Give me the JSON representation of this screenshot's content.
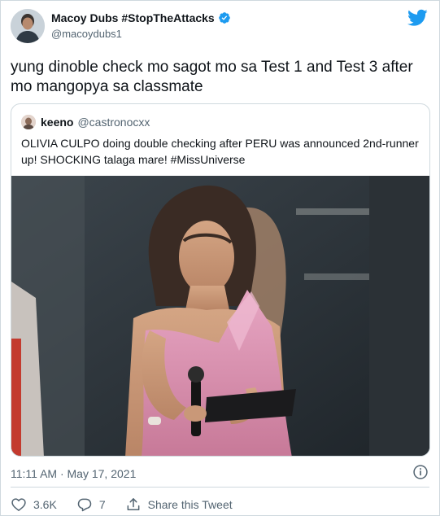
{
  "author": {
    "display_name": "Macoy Dubs #StopTheAttacks",
    "handle": "@macoydubs1",
    "verified": true,
    "avatar_icon": "profile-photo"
  },
  "tweet": {
    "text": "yung dinoble check mo sagot mo sa Test 1 and Test 3 after mo mangopya sa classmate",
    "timestamp": "11:11 AM · May 17, 2021"
  },
  "quoted_tweet": {
    "display_name": "keeno",
    "handle": "@castronocxx",
    "text": "OLIVIA CULPO doing double checking after PERU was announced 2nd-runner up! SHOCKING talaga mare! #MissUniverse",
    "media_alt_icon": "photo"
  },
  "actions": {
    "likes": "3.6K",
    "replies": "7",
    "share_label": "Share this Tweet"
  },
  "colors": {
    "brand": "#1d9bf0",
    "like": "#f91880",
    "muted": "#536471"
  }
}
